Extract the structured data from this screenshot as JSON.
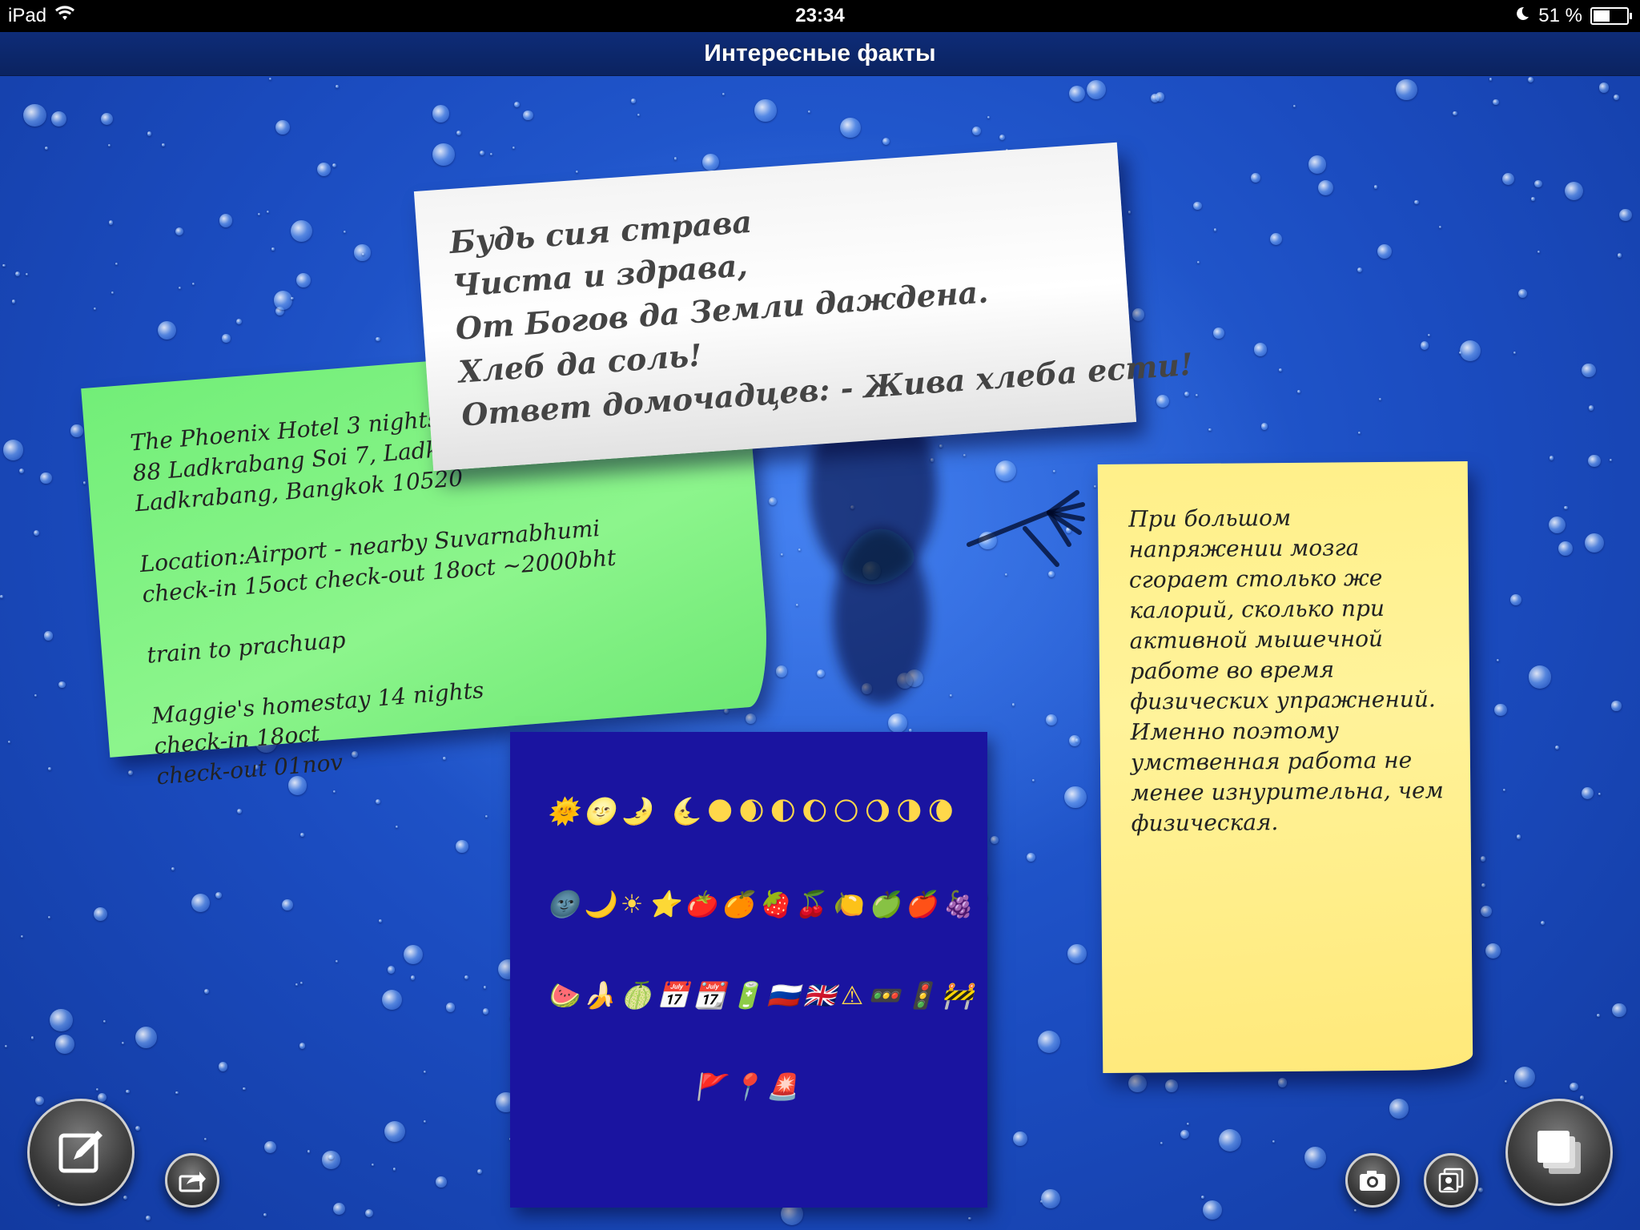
{
  "status_bar": {
    "device": "iPad",
    "time": "23:34",
    "battery": "51 %",
    "battery_level": 0.51
  },
  "nav": {
    "title": "Интересные факты"
  },
  "notes": {
    "green": {
      "lines": [
        "The Phoenix Hotel 3 nights",
        "88 Ladkrabang Soi 7, Ladkrabang",
        "Ladkrabang, Bangkok 10520",
        "",
        "Location:Airport - nearby Suvarnabhumi",
        "check-in 15oct check-out 18oct ~2000bht",
        "",
        "train to prachuap",
        "",
        "Maggie's homestay 14 nights",
        "check-in 18oct",
        "check-out 01nov"
      ]
    },
    "white": {
      "lines": [
        "Будь сия страва",
        "Чиста и здрава,",
        "От Богов да Земли даждена.",
        "Хлеб да соль!",
        "Ответ домочадцев: - Жива хлеба ести!"
      ]
    },
    "yellow": {
      "lines": [
        "При большом",
        "напряжении мозга",
        "сгорает столько же",
        "калорий, сколько при",
        "активной мышечной",
        "работе во время",
        "физических упражнений.",
        "Именно поэтому",
        "умственная работа не",
        "менее изнурительна, чем",
        "физическая."
      ]
    },
    "emoji": {
      "rows": [
        "🌞🌝🌛 🌜🌑🌒🌓🌔🌕🌖🌗🌘",
        "🌚🌙☀⭐🍅🍊🍓🍒🍋🍏🍎🍇",
        "🍉🍌🍈📅📆🔋🇷🇺🇬🇧⚠🚥🚦🚧",
        "🚩📍🚨"
      ]
    }
  },
  "toolbar": {
    "compose_icon": "compose-icon",
    "share_icon": "share-icon",
    "camera_icon": "camera-icon",
    "photo_library_icon": "photo-library-icon",
    "notes_stack_icon": "notes-stack-icon"
  }
}
